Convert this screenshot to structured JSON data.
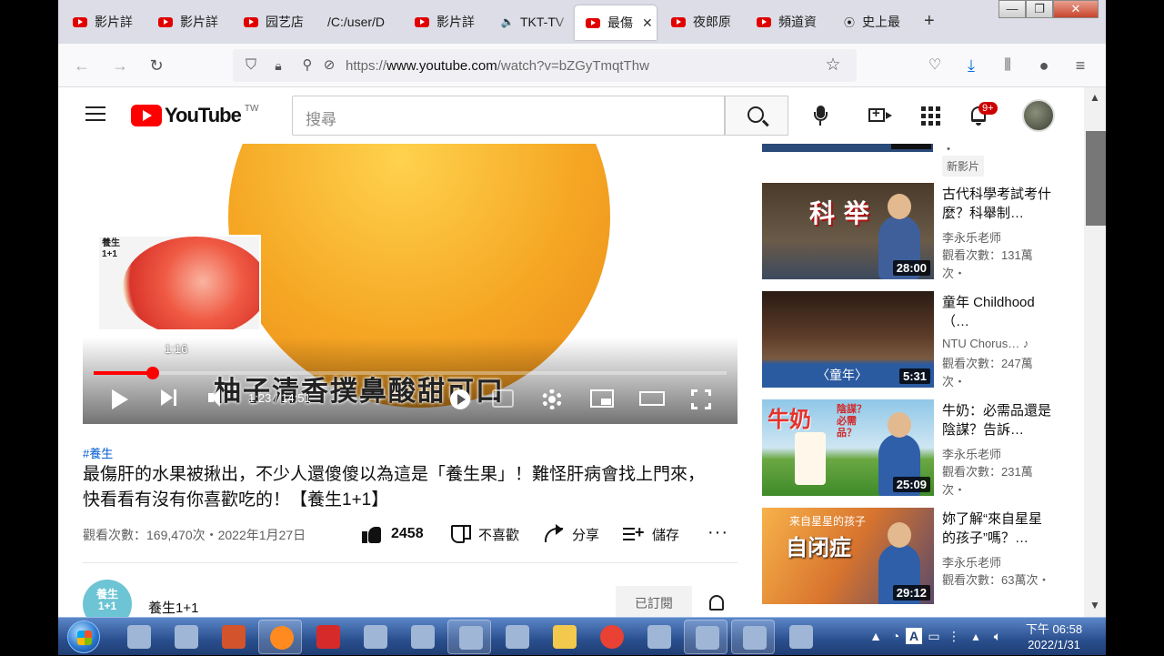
{
  "browser": {
    "tabs": [
      {
        "label": "影片詳",
        "icon": "youtube-icon"
      },
      {
        "label": "影片詳",
        "icon": "youtube-icon"
      },
      {
        "label": "园艺店",
        "icon": "youtube-icon"
      },
      {
        "label": "/C:/user/D",
        "icon": "none"
      },
      {
        "label": "影片詳",
        "icon": "youtube-icon"
      },
      {
        "label": "TKT-TV",
        "icon": "speaker-icon"
      },
      {
        "label": "最傷",
        "icon": "youtube-icon",
        "active": true
      },
      {
        "label": "夜郎原",
        "icon": "youtube-icon"
      },
      {
        "label": "頻道資",
        "icon": "youtube-icon"
      },
      {
        "label": "史上最",
        "icon": "play-circle-icon"
      }
    ],
    "new_tab": "+",
    "tab_close": "✕",
    "url_prefix": "https://",
    "url_domain": "www.youtube.com",
    "url_path": "/watch?v=bZGyTmqtThw",
    "window_controls": {
      "minimize": "—",
      "maximize": "❐",
      "close": "✕"
    }
  },
  "youtube": {
    "region": "TW",
    "logo_word": "YouTube",
    "search_placeholder": "搜尋",
    "notifications_badge": "9+"
  },
  "player": {
    "preview_label": "養生\n1+1",
    "preview_time": "1:16",
    "current_time": "1:23",
    "duration": "14:51",
    "timecode": "1:23 / 14:51",
    "progress_fraction": 0.0931,
    "subtitle": "柚子清香撲鼻酸甜可口"
  },
  "video": {
    "hashtag": "#養生",
    "title": "最傷肝的水果被揪出，不少人還傻傻以為這是「養生果」！難怪肝病會找上門來，快看看有沒有你喜歡吃的！【養生1+1】",
    "meta": "觀看次數：169,470次・2022年1月27日",
    "likes": "2458",
    "dislike_label": "不喜歡",
    "share_label": "分享",
    "save_label": "儲存",
    "more": "···"
  },
  "channel": {
    "name": "養生1+1",
    "avatar_text": "養生\n1+1",
    "subscribe_label": "已訂閱"
  },
  "sidebar": {
    "partial_dot": "・",
    "new_badge": "新影片",
    "items": [
      {
        "title": "古代科學考試考什麼？科舉制…",
        "channel": "李永乐老师",
        "views": "觀看次數：131萬次・",
        "duration": "28:00",
        "thumb_text": "科 举"
      },
      {
        "title": "童年 Childhood（…",
        "channel": "NTU Chorus…",
        "channel_icon": "music-note-icon",
        "views": "觀看次數：247萬次・",
        "duration": "5:31",
        "thumb_text": "〈童年〉"
      },
      {
        "title": "牛奶：必需品還是陰謀？告訴…",
        "channel": "李永乐老师",
        "views": "觀看次數：231萬次・",
        "duration": "25:09",
        "thumb_text": "牛奶",
        "thumb_text2": "陰謀？必需品？"
      },
      {
        "title": "妳了解“來自星星的孩子”嗎？…",
        "channel": "李永乐老师",
        "views": "觀看次數：63萬次・",
        "duration": "29:12",
        "thumb_text": "自闭症",
        "thumb_text2": "来自星星的孩子"
      }
    ]
  },
  "taskbar": {
    "apps": [
      "app-icon",
      "app-icon",
      "powerpoint-icon",
      "firefox-icon",
      "pdf-icon",
      "app-icon",
      "app-icon",
      "app-icon",
      "app-icon",
      "folder-icon",
      "chrome-icon",
      "app-icon",
      "app-icon",
      "app-icon",
      "app-icon"
    ],
    "tray_letter": "A",
    "time": "下午 06:58",
    "date": "2022/1/31"
  },
  "colors": {
    "youtube_red": "#ff0000",
    "link_blue": "#065fd4",
    "tab_strip": "#dcdde6"
  }
}
